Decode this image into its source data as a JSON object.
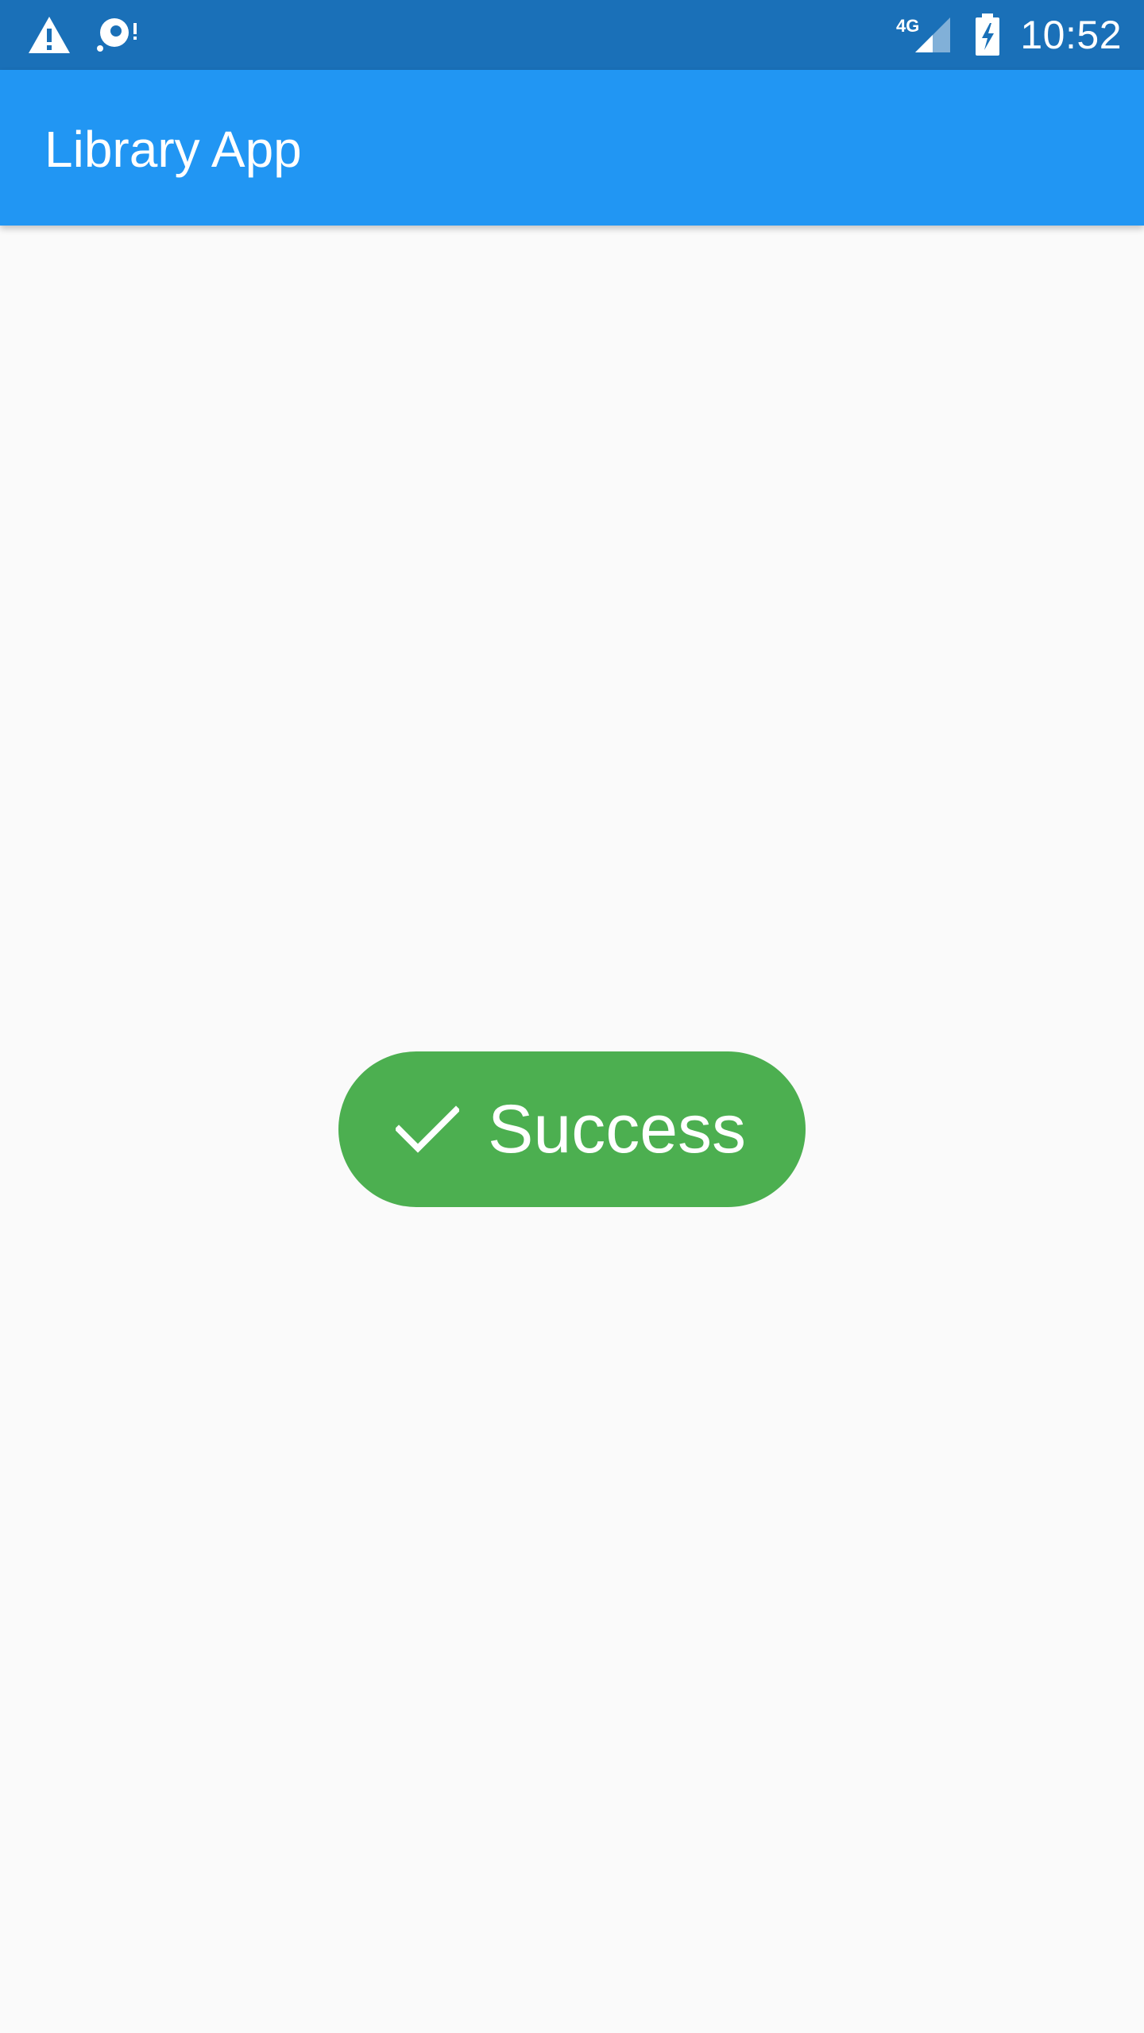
{
  "status_bar": {
    "time": "10:52",
    "network_label": "4G",
    "left_icons": [
      "warning-icon",
      "sync-problem-icon"
    ],
    "right_icons": [
      "signal-4g-icon",
      "battery-charging-icon"
    ]
  },
  "app_bar": {
    "title": "Library App",
    "color": "#2196f3"
  },
  "toast": {
    "icon": "check-icon",
    "text": "Success",
    "color": "#4caf50"
  },
  "colors": {
    "status_bar": "#1a70b8",
    "background": "#fafafa",
    "on_primary": "#ffffff"
  }
}
